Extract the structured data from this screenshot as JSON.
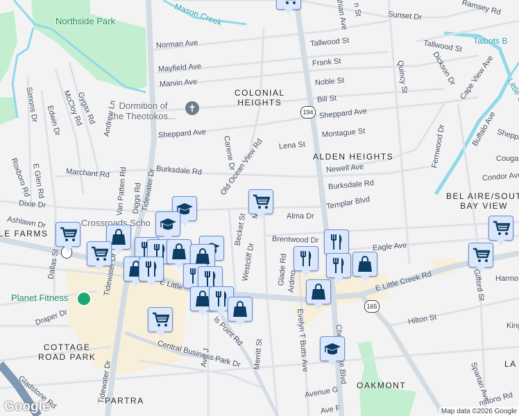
{
  "parks": {
    "northside": "Northside Park"
  },
  "water": {
    "mason": "Mason Creek",
    "talbots": "Talbots B",
    "little_creek": "Little Cr"
  },
  "poi": {
    "church_1": "Dormition of",
    "church_2": "the Theotokos...",
    "school": "Crossroads Scho",
    "gym": "Planet Fitness"
  },
  "neighborhoods": {
    "colonial_1": "COLONIAL",
    "colonial_2": "HEIGHTS",
    "alden": "ALDEN HEIGHTS",
    "belaire_1": "BEL AIRE/SOUT",
    "belaire_2": "BAY VIEW",
    "farms": "LE FARMS",
    "cottage_1": "COTTAGE",
    "cottage_2": "ROAD PARK",
    "partra": "PARTRA",
    "oakmont": "OAKMONT",
    "la": "LA"
  },
  "streets": [
    "Norman Ave",
    "Mayfield Ave",
    "Marvin Ave",
    "Sheppard Ave",
    "Simons Dr",
    "Edwin Dr",
    "McCloy Rd",
    "Gygax Rd",
    "Andrew Ln",
    "Roxboro Rd",
    "E Glen Rd",
    "Marchant Rd",
    "Van Patten Rd",
    "Diggs Rd",
    "Tidewater Dr",
    "Burksdale Rd",
    "Carene Dr",
    "Old Ocean View Rd",
    "Dixie Dr",
    "Tallwood St",
    "Frank St",
    "Noble St",
    "Bill St",
    "Sheppard Ave",
    "Montague St",
    "Lena St",
    "Newell Ave",
    "Burksdale Rd",
    "Templar Blvd",
    "Sunset Dr",
    "Ramsey Rd",
    "thian Ave",
    "n St",
    "Tallwood St",
    "Quincy St",
    "Dickson Dr",
    "Cape View Ave",
    "Fernwood Dr",
    "Buffalo Ave",
    "Sheppa",
    "Cougar",
    "Condor Ave",
    "Ashlawn Dr",
    "Becket St",
    "Westcliff Dr",
    "Alma Dr",
    "Brentwood Dr",
    "Eagle Ave",
    "Glade Rd",
    "Ardmo",
    "Evelyn T Butts Ave",
    "Chesapeake Blvd",
    "E Little Creek Rd",
    "Hilton St",
    "Harmo",
    "Gifford St",
    "King",
    "Spartan Ave",
    "Avenue G",
    "Ave F",
    "nstons Rd",
    "Dallas St",
    "Draper Dr",
    "Gladstone Rd",
    "Tidewater Dr",
    "Central Business Park Dr",
    "Ave J",
    "ls Point Rd",
    "Merritt St",
    "E Little",
    "Tidewater Dr",
    "Mer"
  ],
  "shields": {
    "r194": "194",
    "r165": "165"
  },
  "footer": {
    "logo": "Google",
    "attribution": "Map data ©2026 Google"
  },
  "colors": {
    "marker_bg": "#dbe7fb",
    "marker_icon": "#0d3d63",
    "park": "#c3efd0",
    "commercial": "#f8efdb",
    "water": "#8fd9ea"
  }
}
